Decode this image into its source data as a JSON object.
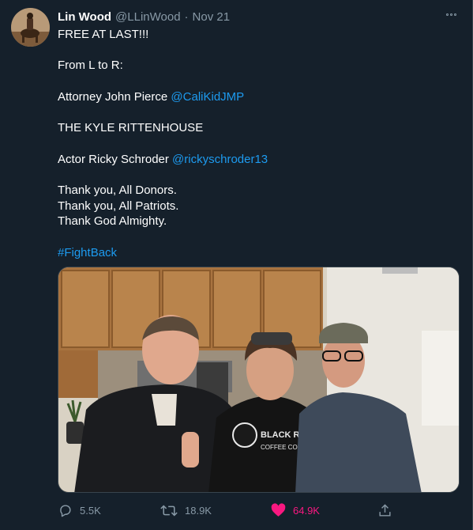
{
  "tweet": {
    "author_name": "Lin Wood",
    "author_handle": "@LLinWood",
    "separator": "·",
    "date": "Nov 21",
    "lines": [
      {
        "text": "FREE AT LAST!!!"
      },
      {
        "text": ""
      },
      {
        "text": "From L to R:"
      },
      {
        "text": ""
      },
      {
        "text": "Attorney John Pierce",
        "mention": "@CaliKidJMP"
      },
      {
        "text": ""
      },
      {
        "text": "THE KYLE RITTENHOUSE"
      },
      {
        "text": ""
      },
      {
        "text": "Actor Ricky Schroder",
        "mention": "@rickyschroder13"
      },
      {
        "text": ""
      },
      {
        "text": "Thank you, All Donors."
      },
      {
        "text": "Thank you, All Patriots."
      },
      {
        "text": "Thank God Almighty."
      },
      {
        "text": ""
      },
      {
        "hashtag": "#FightBack"
      }
    ],
    "photo": {
      "shirt_text_1": "BLACK RIFLE",
      "shirt_text_2": "COFFEE COMPANY"
    }
  },
  "actions": {
    "reply_count": "5.5K",
    "retweet_count": "18.9K",
    "like_count": "64.9K"
  },
  "colors": {
    "background": "#15202b",
    "secondary_text": "#8899a6",
    "link": "#1d9bf0",
    "like": "#f91880"
  },
  "icons": {
    "more": "more-horizontal-icon",
    "reply": "reply-icon",
    "retweet": "retweet-icon",
    "like": "heart-icon",
    "share": "share-icon"
  }
}
